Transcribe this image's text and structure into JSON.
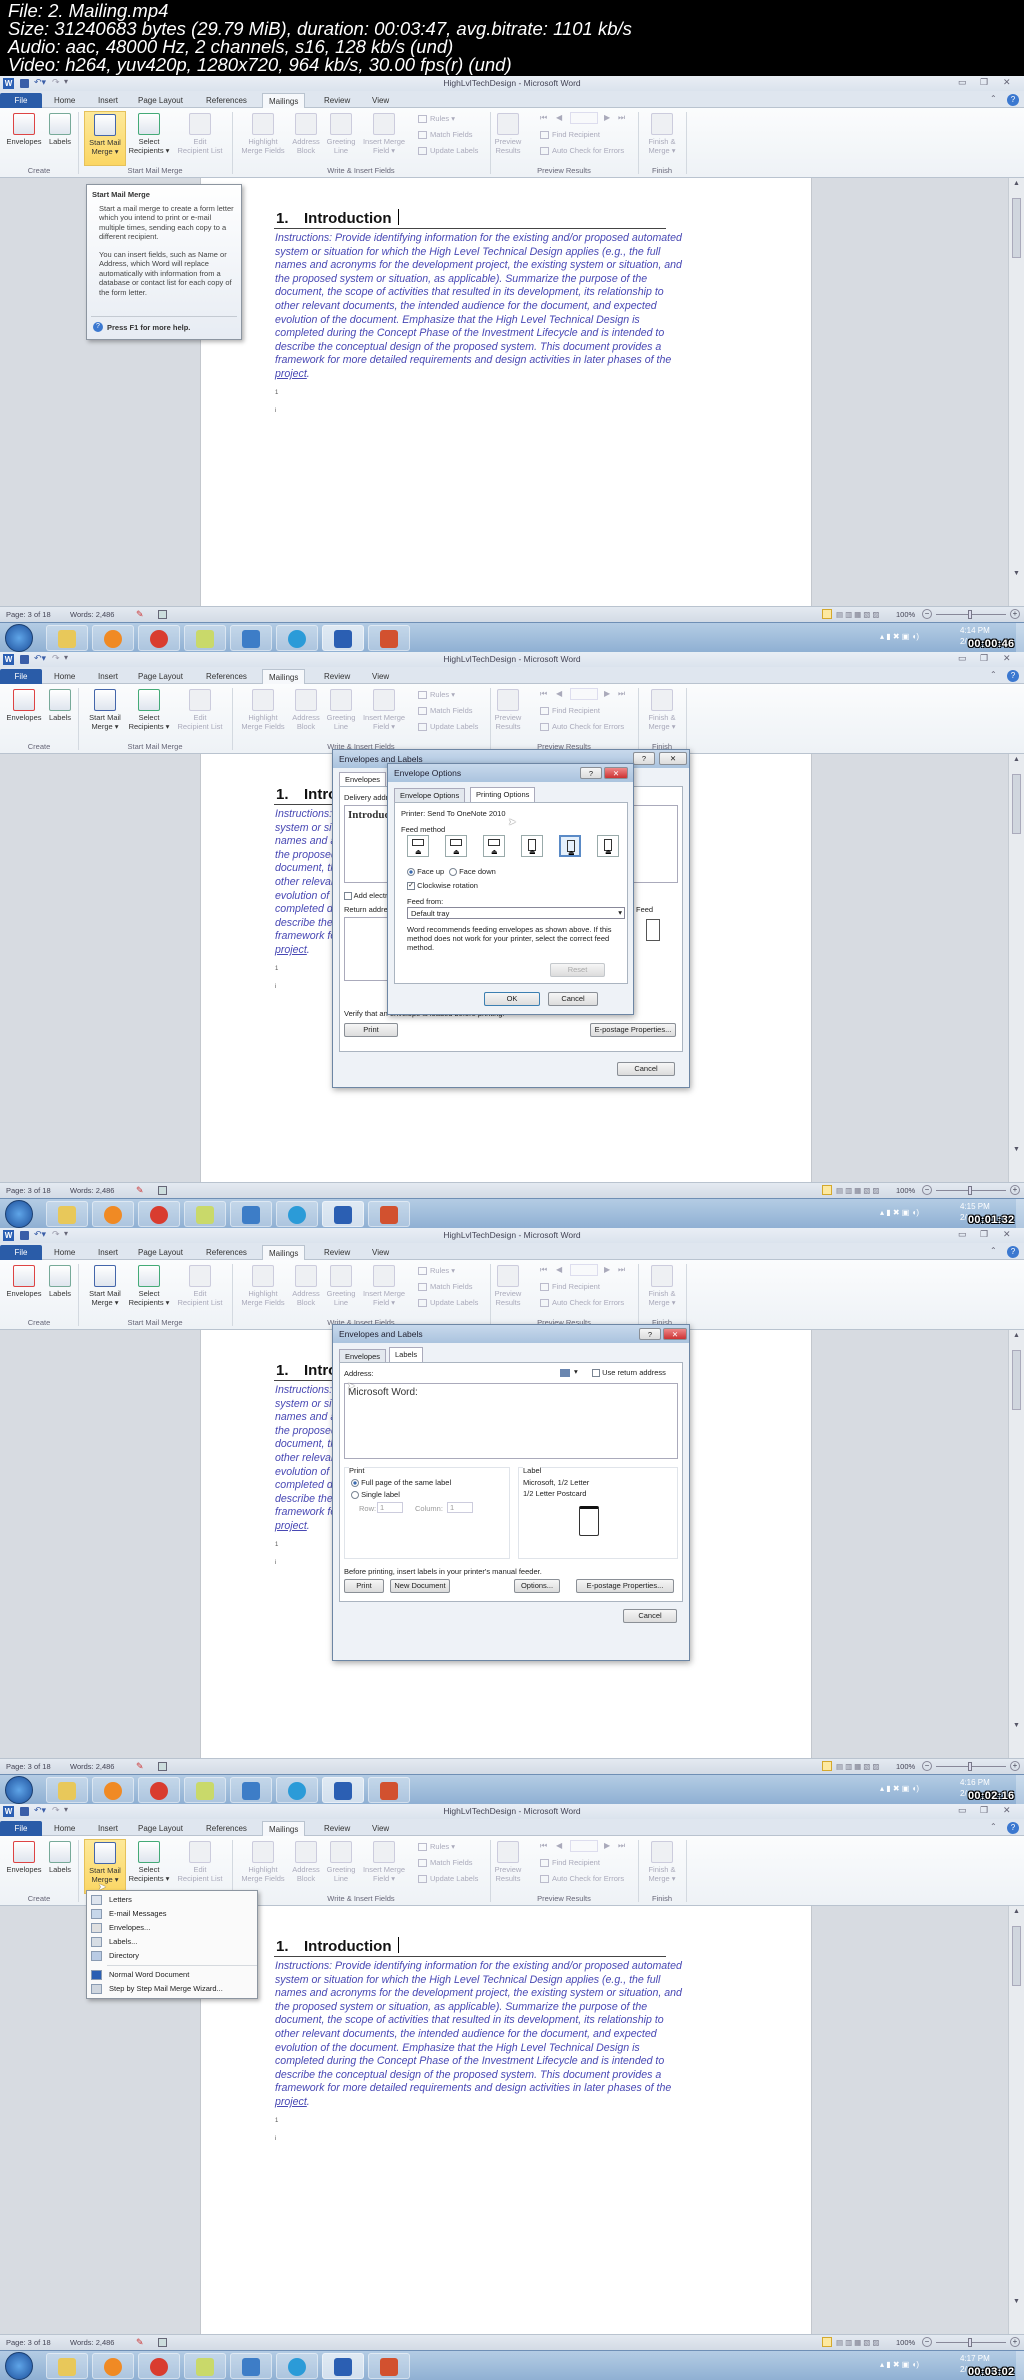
{
  "header": {
    "file": "File: 2. Mailing.mp4",
    "size": "Size: 31240683 bytes (29.79 MiB), duration: 00:03:47, avg.bitrate: 1101 kb/s",
    "audio": "Audio: aac, 48000 Hz, 2 channels, s16, 128 kb/s (und)",
    "video": "Video: h264, yuv420p, 1280x720, 964 kb/s, 30.00 fps(r) (und)"
  },
  "word": {
    "title": "HighLvlTechDesign - Microsoft Word",
    "tabs": [
      "File",
      "Home",
      "Insert",
      "Page Layout",
      "References",
      "Mailings",
      "Review",
      "View"
    ],
    "active_tab": "Mailings",
    "ribbon": {
      "buttons": [
        {
          "l1": "Envelopes",
          "l2": "",
          "enabled": true
        },
        {
          "l1": "Labels",
          "l2": "",
          "enabled": true
        },
        {
          "l1": "Start Mail",
          "l2": "Merge ▾",
          "enabled": true
        },
        {
          "l1": "Select",
          "l2": "Recipients ▾",
          "enabled": true
        },
        {
          "l1": "Edit",
          "l2": "Recipient List",
          "enabled": false
        },
        {
          "l1": "Highlight",
          "l2": "Merge Fields",
          "enabled": false
        },
        {
          "l1": "Address",
          "l2": "Block",
          "enabled": false
        },
        {
          "l1": "Greeting",
          "l2": "Line",
          "enabled": false
        },
        {
          "l1": "Insert Merge",
          "l2": "Field ▾",
          "enabled": false
        },
        {
          "l1": "Preview",
          "l2": "Results",
          "enabled": false
        },
        {
          "l1": "Finish &",
          "l2": "Merge ▾",
          "enabled": false
        }
      ],
      "small": [
        "Rules ▾",
        "Match Fields",
        "Update Labels",
        "Find Recipient",
        "Auto Check for Errors"
      ],
      "groups": [
        "Create",
        "Start Mail Merge",
        "Write & Insert Fields",
        "Preview Results",
        "Finish"
      ]
    },
    "status": {
      "page": "Page: 3 of 18",
      "words": "Words: 2,486",
      "zoom": "100%"
    }
  },
  "document": {
    "heading_number": "1.",
    "heading": "Introduction",
    "body_lines": [
      "Instructions:  Provide identifying information for the existing and/or proposed automated",
      "system or situation for which the High Level Technical Design applies (e.g., the full",
      "names and acronyms for the development project, the existing system or situation, and",
      "the proposed system or situation, as applicable). Summarize the purpose of the",
      "document, the scope of activities that resulted in its development, its relationship to",
      "other relevant documents, the intended audience for the document, and expected",
      "evolution of the document. Emphasize that the High Level Technical Design is",
      "completed during the Concept Phase of the Investment Lifecycle and is intended to",
      "describe the conceptual design of the proposed system. This document provides a",
      "framework for more detailed requirements and design activities in later phases of the"
    ],
    "last_word": "project",
    "last_punct": ".",
    "marks": [
      "1",
      "i"
    ]
  },
  "frames": [
    {
      "clock": "4:14 PM",
      "date": "2/",
      "timestamp": "00:00:46"
    },
    {
      "clock": "4:15 PM",
      "date": "2/",
      "timestamp": "00:01:32"
    },
    {
      "clock": "4:16 PM",
      "date": "2/",
      "timestamp": "00:02:16"
    },
    {
      "clock": "4:17 PM",
      "date": "2/",
      "timestamp": "00:03:02"
    }
  ],
  "tooltip": {
    "title": "Start Mail Merge",
    "p1": "Start a mail merge to create a form letter which you intend to print or e-mail multiple times, sending each copy to a different recipient.",
    "p2": "You can insert fields, such as Name or Address, which Word will replace automatically with information from a database or contact list for each copy of the form letter.",
    "help": "Press F1 for more help."
  },
  "envelopes_dialog": {
    "title": "Envelopes and Labels",
    "tab_envelopes": "Envelopes",
    "tab_labels": "Labels",
    "delivery_label": "Delivery address:",
    "delivery_value": "Introduction",
    "add_postage": "Add electronic postage",
    "return_label": "Return address:",
    "verify": "Verify that an envelope is loaded before printing.",
    "feed": "Feed",
    "print": "Print",
    "properties": "E-postage Properties...",
    "cancel": "Cancel"
  },
  "envelope_options": {
    "title": "Envelope Options",
    "tab1": "Envelope Options",
    "tab2": "Printing Options",
    "printer": "Printer:   Send To OneNote 2010",
    "feed_method": "Feed method",
    "face_up": "Face up",
    "face_down": "Face down",
    "clockwise": "Clockwise rotation",
    "feed_from": "Feed from:",
    "tray": "Default tray",
    "note": "Word recommends feeding envelopes as shown above. If this method does not work for your printer, select the correct feed method.",
    "reset": "Reset",
    "ok": "OK",
    "cancel": "Cancel"
  },
  "labels_dialog": {
    "title": "Envelopes and Labels",
    "tab_envelopes": "Envelopes",
    "tab_labels": "Labels",
    "address_label": "Address:",
    "use_return": "Use return address",
    "address_value": "Microsoft Word:",
    "print_group": "Print",
    "full_page": "Full page of the same label",
    "single": "Single label",
    "row_label": "Row:",
    "row_value": "1",
    "col_label": "Column:",
    "col_value": "1",
    "label_group": "Label",
    "label_name": "Microsoft,  1/2 Letter",
    "label_type": "1/2 Letter Postcard",
    "hint": "Before printing, insert labels in your printer's manual feeder.",
    "print": "Print",
    "new_doc": "New Document",
    "options": "Options...",
    "epostage": "E-postage Properties...",
    "cancel": "Cancel"
  },
  "start_mail_merge_menu": [
    "Letters",
    "E-mail Messages",
    "Envelopes...",
    "Labels...",
    "Directory",
    "Normal Word Document",
    "Step by Step Mail Merge Wizard..."
  ]
}
